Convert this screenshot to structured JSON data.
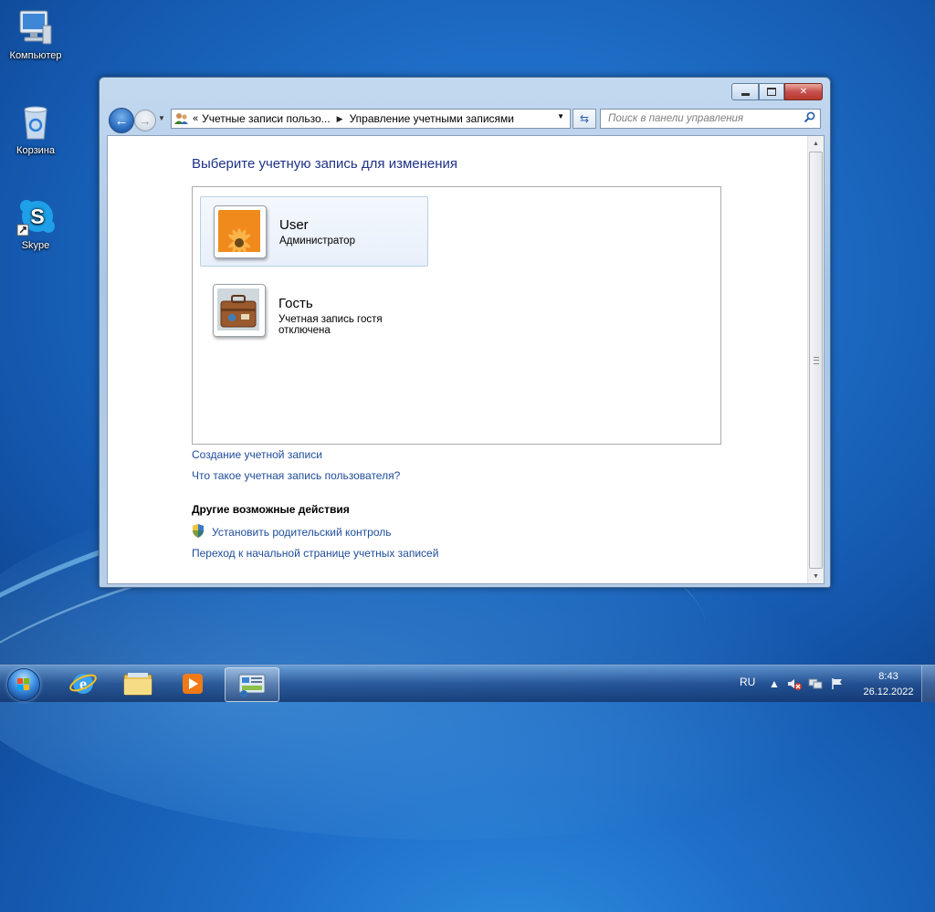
{
  "desktop": {
    "icons": [
      {
        "label": "Компьютер",
        "icon": "computer-icon"
      },
      {
        "label": "Корзина",
        "icon": "recycle-bin-icon"
      },
      {
        "label": "Skype",
        "icon": "skype-icon"
      }
    ]
  },
  "window": {
    "caption_buttons": {
      "minimize": "minimize-icon",
      "maximize": "maximize-icon",
      "close": "close-icon"
    },
    "address": {
      "chevron": "«",
      "crumbs": [
        "Учетные записи пользо...",
        "Управление учетными записями"
      ]
    },
    "search_placeholder": "Поиск в панели управления",
    "heading": "Выберите учетную запись для изменения",
    "accounts": [
      {
        "name": "User",
        "role": "Администратор",
        "picture": "flower-icon",
        "selected": true
      },
      {
        "name": "Гость",
        "role": "Учетная запись гостя отключена",
        "picture": "suitcase-icon",
        "selected": false
      }
    ],
    "links": {
      "create": "Создание учетной записи",
      "what_is": "Что такое учетная запись пользователя?"
    },
    "other_actions": {
      "heading": "Другие возможные действия",
      "parental": "Установить родительский контроль",
      "main_page": "Переход к начальной странице учетных записей"
    }
  },
  "taskbar": {
    "pinned": [
      "start-orb-icon",
      "internet-explorer-icon",
      "explorer-folder-icon",
      "media-player-icon",
      "control-panel-icon"
    ],
    "language": "RU",
    "clock": {
      "time": "8:43",
      "date": "26.12.2022"
    }
  },
  "colors": {
    "link": "#1e4c9a",
    "heading": "#1e3287"
  }
}
